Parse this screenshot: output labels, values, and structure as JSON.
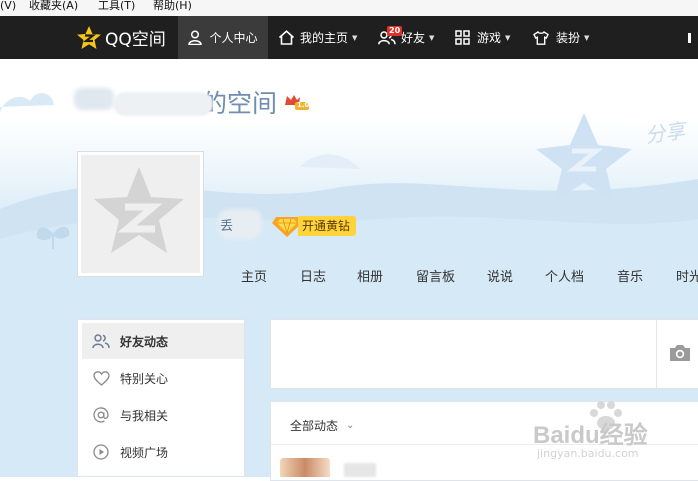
{
  "browser_menu": {
    "view": "(V)",
    "favorites": "收藏夹(A)",
    "tools": "工具(T)",
    "help": "帮助(H)"
  },
  "topnav": {
    "logo": "QQ空间",
    "personal_center": "个人中心",
    "my_homepage": "我的主页",
    "friends": "好友",
    "friends_badge": "20",
    "games": "游戏",
    "decorate": "装扮"
  },
  "header": {
    "space_title": "的空间",
    "level_badge": "1.0",
    "nickname_fragment": "丢",
    "vip_button": "开通黄钻",
    "decor_text": "分享"
  },
  "profile_tabs": [
    "主页",
    "日志",
    "相册",
    "留言板",
    "说说",
    "个人档",
    "音乐",
    "时光"
  ],
  "sidebar": {
    "items": [
      {
        "label": "好友动态",
        "icon": "friends-icon"
      },
      {
        "label": "特别关心",
        "icon": "heart-icon"
      },
      {
        "label": "与我相关",
        "icon": "at-icon"
      },
      {
        "label": "视频广场",
        "icon": "play-icon"
      }
    ]
  },
  "feed": {
    "filter_label": "全部动态"
  },
  "watermark": {
    "main": "Baidu经验",
    "url": "jingyan.baidu.com"
  },
  "colors": {
    "nav_bg": "#1f1f1f",
    "title_blue": "#6e8db0",
    "vip_yellow": "#ffd33a",
    "banner_blue": "#d5e9f6"
  }
}
